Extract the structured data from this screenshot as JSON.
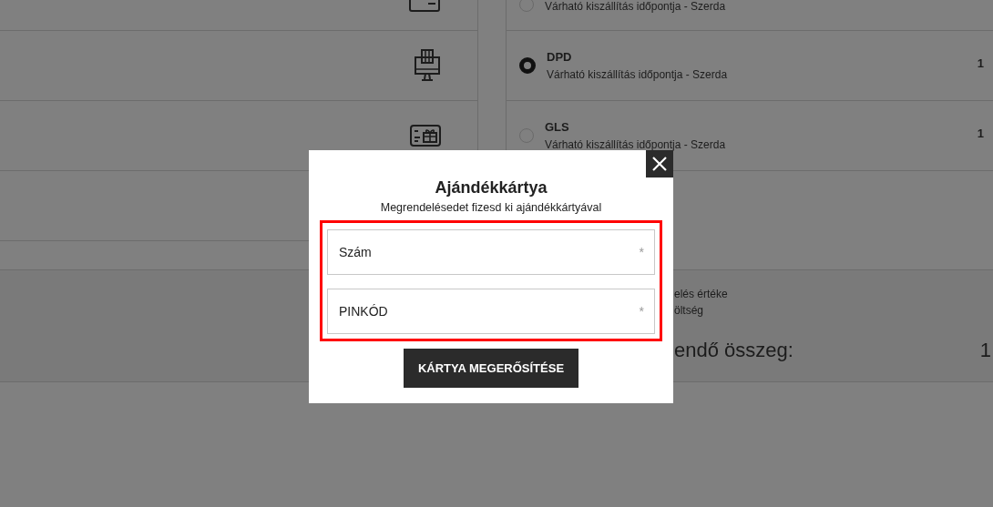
{
  "payment_methods": [
    {
      "kind": "card"
    },
    {
      "kind": "terminal"
    },
    {
      "kind": "giftcard"
    }
  ],
  "shipping_options": [
    {
      "subtitle": "Várható kiszállítás időpontja - Szerda",
      "selected": false
    },
    {
      "name": "DPD",
      "subtitle": "Várható kiszállítás időpontja - Szerda",
      "price": "1",
      "selected": true
    },
    {
      "name": "GLS",
      "subtitle": "Várható kiszállítás időpontja - Szerda",
      "price": "1",
      "selected": false
    }
  ],
  "summary": {
    "lines": [
      "elés értéke",
      "öltség"
    ],
    "total_label": "endő összeg:",
    "total_value": "1"
  },
  "modal": {
    "title": "Ajándékkártya",
    "subtitle": "Megrendelésedet fizesd ki ajándékkártyával",
    "highlighted": true,
    "fields": [
      {
        "placeholder": "Szám",
        "required_mark": "*"
      },
      {
        "placeholder": "PINKÓD",
        "required_mark": "*"
      }
    ],
    "button": "KÁRTYA MEGERŐSÍTÉSE"
  }
}
